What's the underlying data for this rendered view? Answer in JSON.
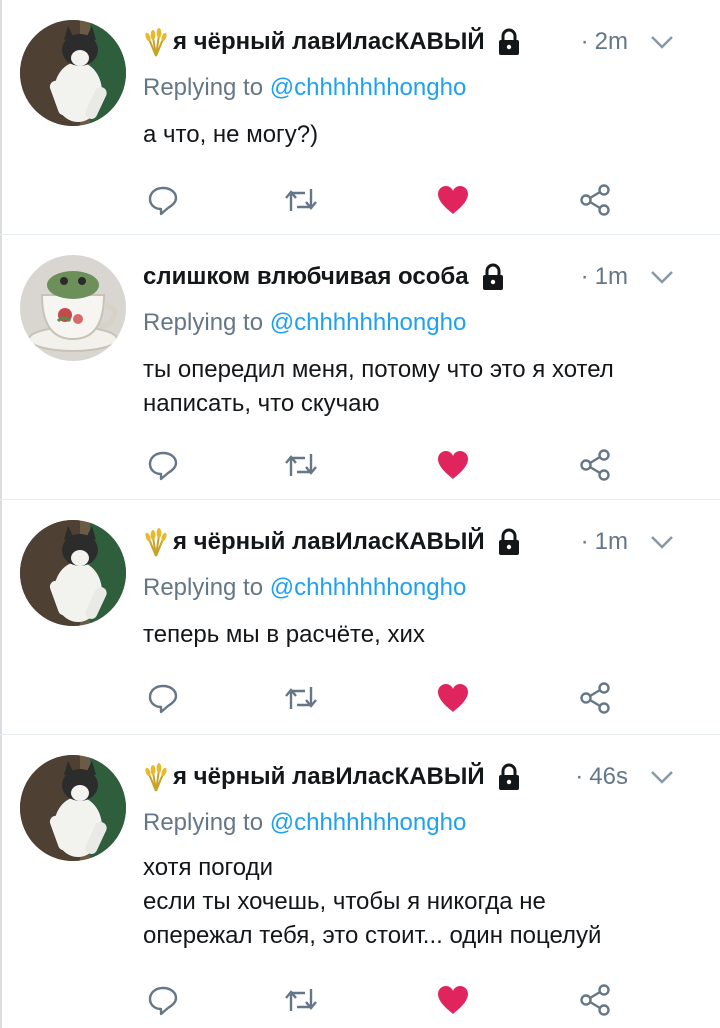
{
  "replying_prefix": "Replying to",
  "tweets": [
    {
      "name": "я чёрный лавИласКАВЫЙ",
      "has_emoji": true,
      "time": "2m",
      "time_dot": "·",
      "reply_handle": "@chhhhhhhongho",
      "lines": [
        "а что, не могу?)"
      ],
      "avatar": "cat-avatar",
      "liked": true
    },
    {
      "name": "слишком влюбчивая особа",
      "has_emoji": false,
      "time": "1m",
      "time_dot": "·",
      "reply_handle": "@chhhhhhhongho",
      "lines": [
        "ты опередил меня, потому что это я хотел",
        "написать, что скучаю"
      ],
      "avatar": "teacup-avatar",
      "liked": true
    },
    {
      "name": "я чёрный лавИласКАВЫЙ",
      "has_emoji": true,
      "time": "1m",
      "time_dot": "·",
      "reply_handle": "@chhhhhhhongho",
      "lines": [
        "теперь мы в расчёте, хих"
      ],
      "avatar": "cat-avatar",
      "liked": true
    },
    {
      "name": "я чёрный лавИласКАВЫЙ",
      "has_emoji": true,
      "time": "46s",
      "time_dot": "·",
      "reply_handle": "@chhhhhhhongho",
      "lines": [
        "хотя погоди",
        "если ты хочешь, чтобы я никогда не",
        "опережал тебя, это стоит... один поцелуй"
      ],
      "avatar": "cat-avatar",
      "liked": true
    }
  ],
  "icons": {
    "reply": "reply-icon",
    "retweet": "retweet-icon",
    "like": "heart-icon",
    "share": "share-icon",
    "lock": "lock-icon",
    "chevron": "chevron-down-icon",
    "emoji": "sheaf-of-rice-icon"
  },
  "colors": {
    "name_text": "#14171a",
    "secondary_text": "#657786",
    "link": "#1da1f2",
    "like_active": "#e0245e",
    "icon_gray": "#657786",
    "divider": "#e6ecf0"
  }
}
